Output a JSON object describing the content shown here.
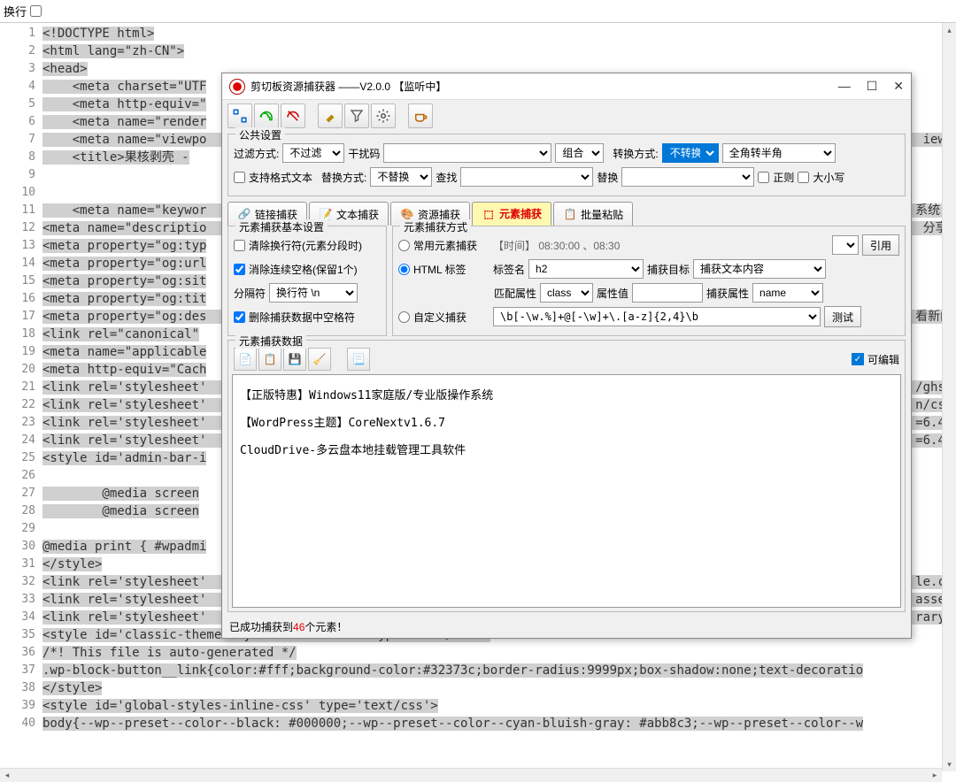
{
  "topbar": {
    "wrap_label": "换行"
  },
  "code_lines": [
    "<!DOCTYPE html>",
    "<html lang=\"zh-CN\">",
    "<head>",
    "    <meta charset=\"UTF",
    "    <meta http-equiv=\"",
    "    <meta name=\"render",
    "    <meta name=\"viewpo                                                                                                iewp",
    "    <title>果核剥壳 -",
    "",
    "",
    "    <meta name=\"keywor                                                                                               系统,",
    "<meta name=\"descriptio                                                                                                分享",
    "<meta property=\"og:typ",
    "<meta property=\"og:url",
    "<meta property=\"og:sit",
    "<meta property=\"og:tit",
    "<meta property=\"og:des                                                                                               看新闻",
    "<link rel=\"canonical\"",
    "<meta name=\"applicable",
    "<meta http-equiv=\"Cach",
    "<link rel='stylesheet'                                                                                               /ghs",
    "<link rel='stylesheet'                                                                                               n/cs",
    "<link rel='stylesheet'                                                                                               =6.4",
    "<link rel='stylesheet'                                                                                               =6.4",
    "<style id='admin-bar-i",
    "",
    "        @media screen",
    "        @media screen",
    "",
    "@media print { #wpadmi",
    "</style>",
    "<link rel='stylesheet'                                                                                               le.c",
    "<link rel='stylesheet'                                                                                               asse",
    "<link rel='stylesheet'                                                                                               rary",
    "<style id='classic-theme-styles-inline-css' type='text/css'>",
    "/*! This file is auto-generated */",
    ".wp-block-button__link{color:#fff;background-color:#32373c;border-radius:9999px;box-shadow:none;text-decoratio",
    "</style>",
    "<style id='global-styles-inline-css' type='text/css'>",
    "body{--wp--preset--color--black: #000000;--wp--preset--color--cyan-bluish-gray: #abb8c3;--wp--preset--color--w"
  ],
  "dialog": {
    "title": "剪切板资源捕获器  ——V2.0.0 【监听中】",
    "common_settings": "公共设置",
    "filter_label": "过滤方式:",
    "filter_value": "不过滤",
    "noise_label": "干扰码",
    "combine_label": "组合",
    "convert_label": "转换方式:",
    "convert_value": "不转换",
    "fullhalf": "全角转半角",
    "support_fmt": "支持格式文本",
    "replace_label": "替换方式:",
    "replace_value": "不替换",
    "find_label": "查找",
    "repl_label": "替换",
    "regex": "正则",
    "case": "大小写",
    "tabs": [
      "链接捕获",
      "文本捕获",
      "资源捕获",
      "元素捕获",
      "批量粘贴"
    ],
    "basic_legend": "元素捕获基本设置",
    "clear_newline": "清除换行符(元素分段时)",
    "clear_spaces": "消除连续空格(保留1个)",
    "sep_label": "分隔符",
    "sep_value": "换行符 \\n",
    "clear_captured_spaces": "删除捕获数据中空格符",
    "method_legend": "元素捕获方式",
    "common_elem": "常用元素捕获",
    "time_example": "【时间】 08:30:00 、08:30",
    "quote_btn": "引用",
    "html_tag": "HTML 标签",
    "tagname_label": "标签名",
    "tagname_value": "h2",
    "target_label": "捕获目标",
    "target_value": "捕获文本内容",
    "match_attr_label": "匹配属性",
    "match_attr_value": "class",
    "attr_val_label": "属性值",
    "cap_attr_label": "捕获属性",
    "cap_attr_value": "name",
    "custom_cap": "自定义捕获",
    "custom_regex": "\\b[-\\w.%]+@[-\\w]+\\.[a-z]{2,4}\\b",
    "test_btn": "测试",
    "data_legend": "元素捕获数据",
    "editable": "可编辑",
    "data_lines": [
      "【正版特惠】Windows11家庭版/专业版操作系统",
      "【WordPress主题】CoreNextv1.6.7",
      "CloudDrive-多云盘本地挂载管理工具软件"
    ],
    "status_prefix": "已成功捕获到",
    "status_count": "46",
    "status_suffix": "个元素！"
  }
}
